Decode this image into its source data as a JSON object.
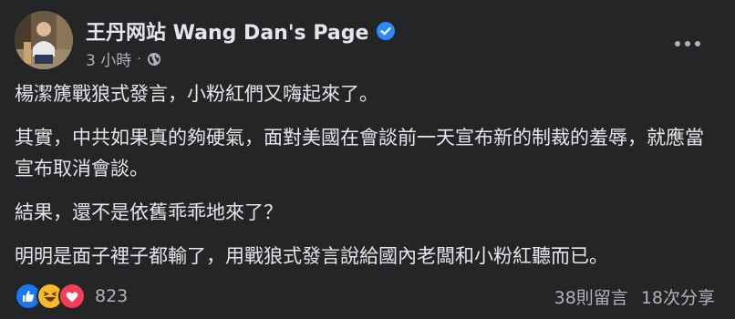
{
  "post": {
    "author": "王丹网站 Wang Dan's Page",
    "timestamp": "3 小時",
    "separator": "·",
    "audience_icon": "globe-icon",
    "verified_icon": "verified-badge-icon",
    "more_icon": "more-options-icon",
    "paragraphs": [
      "楊潔篪戰狼式發言，小粉紅們又嗨起來了。",
      "其實，中共如果真的夠硬氣，面對美國在會談前一天宣布新的制裁的羞辱，就應當宣布取消會談。",
      "結果，還不是依舊乖乖地來了？",
      "明明是面子裡子都輸了，用戰狼式發言說給國內老闆和小粉紅聽而已。"
    ]
  },
  "engagement": {
    "reaction_icons": [
      "like-icon",
      "haha-icon",
      "love-icon"
    ],
    "reaction_count": "823",
    "comments": "38則留言",
    "shares": "18次分享"
  },
  "colors": {
    "background": "#242526",
    "primary_text": "#e4e6eb",
    "secondary_text": "#b0b3b8",
    "verified_blue": "#2d88ff",
    "like_blue": "#1877f2",
    "haha_yellow": "#f7b928",
    "love_red": "#f33e58"
  }
}
